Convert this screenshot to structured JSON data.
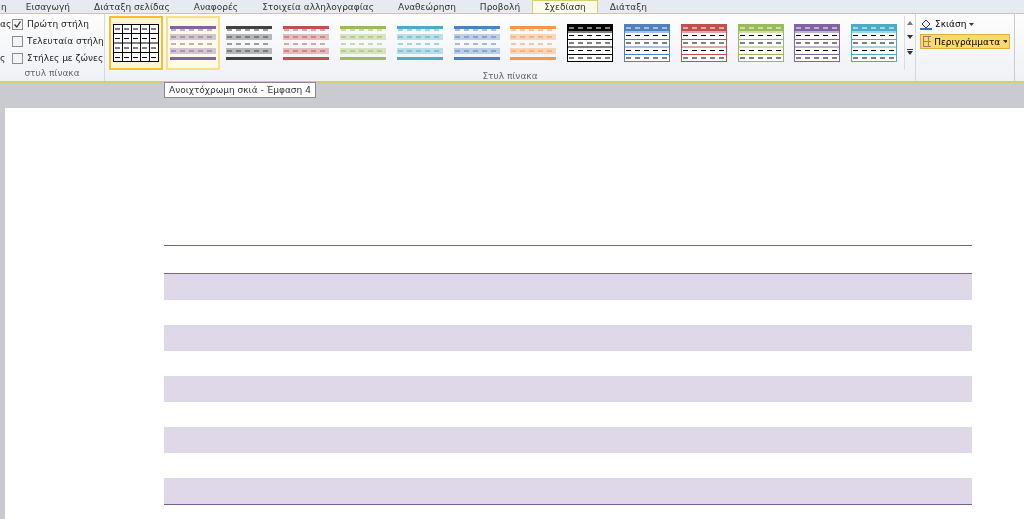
{
  "tabs": [
    {
      "label": "η",
      "selected": false
    },
    {
      "label": "Εισαγωγή",
      "selected": false
    },
    {
      "label": "Διάταξη σελίδας",
      "selected": false
    },
    {
      "label": "Αναφορές",
      "selected": false
    },
    {
      "label": "Στοιχεία αλληλογραφίας",
      "selected": false
    },
    {
      "label": "Αναθεώρηση",
      "selected": false
    },
    {
      "label": "Προβολή",
      "selected": false
    },
    {
      "label": "Σχεδίαση",
      "selected": true
    },
    {
      "label": "Διάταξη",
      "selected": false
    }
  ],
  "options": {
    "cut_labels": [
      "ας",
      "ς"
    ],
    "checkboxes": [
      {
        "label": "Πρώτη στήλη",
        "checked": true
      },
      {
        "label": "Τελευταία στήλη",
        "checked": false
      },
      {
        "label": "Στήλες με ζώνες",
        "checked": false
      }
    ],
    "group_label": "στυλ πίνακα"
  },
  "styles": {
    "items": [
      {
        "kind": "grid",
        "color": "#000000",
        "selected": true,
        "hovered": false
      },
      {
        "kind": "shading",
        "color": "#8064a2",
        "selected": false,
        "hovered": true
      },
      {
        "kind": "shading",
        "color": "#404040",
        "selected": false,
        "hovered": false
      },
      {
        "kind": "shading",
        "color": "#c0504d",
        "selected": false,
        "hovered": false
      },
      {
        "kind": "shading",
        "color": "#9bbb59",
        "selected": false,
        "hovered": false
      },
      {
        "kind": "shading",
        "color": "#4bacc6",
        "selected": false,
        "hovered": false
      },
      {
        "kind": "shading",
        "color": "#4f81bd",
        "selected": false,
        "hovered": false
      },
      {
        "kind": "shading",
        "color": "#f79646",
        "selected": false,
        "hovered": false
      },
      {
        "kind": "header",
        "color": "#000000",
        "selected": false,
        "hovered": false
      },
      {
        "kind": "header",
        "color": "#4f81bd",
        "selected": false,
        "hovered": false
      },
      {
        "kind": "header",
        "color": "#c0504d",
        "selected": false,
        "hovered": false
      },
      {
        "kind": "header",
        "color": "#9bbb59",
        "selected": false,
        "hovered": false
      },
      {
        "kind": "header",
        "color": "#8064a2",
        "selected": false,
        "hovered": false
      },
      {
        "kind": "header",
        "color": "#4bacc6",
        "selected": false,
        "hovered": false
      }
    ],
    "group_label": "Στυλ πίνακα"
  },
  "shading_button": {
    "label": "Σκιάση"
  },
  "borders_button": {
    "label": "Περιγράμματα",
    "pressed": true
  },
  "tooltip": "Ανοιχτόχρωμη σκιά - Έμφαση 4",
  "table": {
    "rows": [
      {
        "kind": "band"
      },
      {
        "kind": "plain"
      },
      {
        "kind": "band"
      },
      {
        "kind": "plain"
      },
      {
        "kind": "band"
      },
      {
        "kind": "plain"
      },
      {
        "kind": "band"
      },
      {
        "kind": "plain"
      },
      {
        "kind": "band"
      }
    ]
  }
}
